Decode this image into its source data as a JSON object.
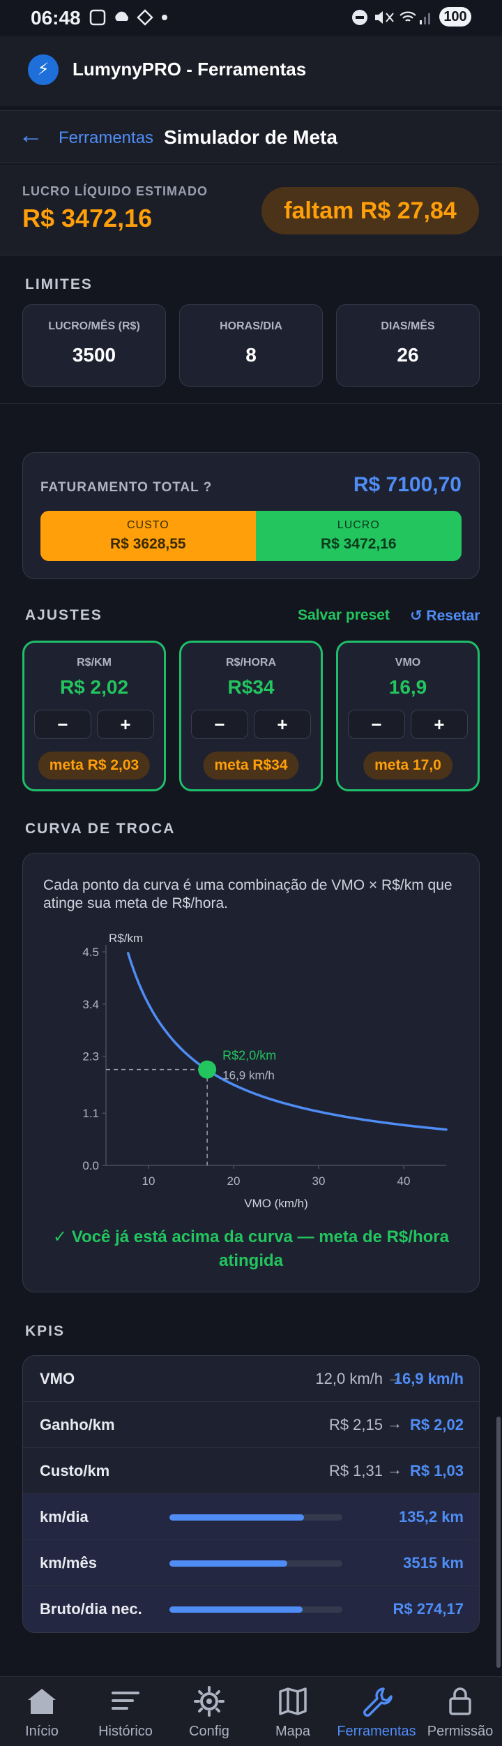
{
  "status_bar": {
    "time": "06:48",
    "battery": "100"
  },
  "app": {
    "title": "LumynyPRO - Ferramentas",
    "logo_icon": "bolt-icon"
  },
  "breadcrumb": {
    "parent": "Ferramentas",
    "title": "Simulador de Meta"
  },
  "summary": {
    "label": "LUCRO LÍQUIDO ESTIMADO",
    "value": "R$ 3472,16",
    "faltam": "faltam R$ 27,84"
  },
  "limites": {
    "title": "LIMITES",
    "items": [
      {
        "label": "LUCRO/MÊS (R$)",
        "value": "3500"
      },
      {
        "label": "HORAS/DIA",
        "value": "8"
      },
      {
        "label": "DIAS/MÊS",
        "value": "26"
      }
    ]
  },
  "faturamento": {
    "label": "FATURAMENTO TOTAL  ?",
    "value": "R$ 7100,70",
    "custo": {
      "label": "CUSTO",
      "value": "R$ 3628,55",
      "share": 0.511
    },
    "lucro": {
      "label": "LUCRO",
      "value": "R$ 3472,16",
      "share": 0.489
    }
  },
  "ajustes": {
    "title": "AJUSTES",
    "save_label": "Salvar preset",
    "reset_label": "↺ Resetar",
    "minus": "−",
    "plus": "+",
    "items": [
      {
        "label": "R$/KM",
        "value": "R$ 2,02",
        "meta": "meta R$ 2,03"
      },
      {
        "label": "R$/HORA",
        "value": "R$34",
        "meta": "meta R$34"
      },
      {
        "label": "VMO",
        "value": "16,9",
        "meta": "meta 17,0"
      }
    ]
  },
  "curva": {
    "title": "CURVA DE TROCA",
    "description": "Cada ponto da curva é uma combinação de VMO × R$/km que atinge sua meta de R$/hora.",
    "success": "✓ Você já está acima da curva — meta de R$/hora atingida"
  },
  "chart_data": {
    "type": "line",
    "ylabel": "R$/km",
    "xlabel": "VMO (km/h)",
    "x_ticks": [
      "10",
      "20",
      "30",
      "40"
    ],
    "y_ticks": [
      "4.5",
      "3.4",
      "2.3",
      "1.1",
      "0.0"
    ],
    "xlim": [
      5,
      45
    ],
    "ylim": [
      0,
      4.5
    ],
    "series": [
      {
        "curve_constant": 34,
        "x_from": 7.6,
        "x_to": 45
      }
    ],
    "point": {
      "x": 16.9,
      "y": 2.02,
      "label_top": "R$2,0/km",
      "label_bottom": "16,9 km/h"
    },
    "colors": {
      "line": "#4f8df5",
      "point": "#22c55e"
    }
  },
  "kpis": {
    "title": "KPIS",
    "rows": [
      {
        "name": "VMO",
        "from": "12,0 km/h",
        "arrow": "→",
        "to": "16,9 km/h"
      },
      {
        "name": "Ganho/km",
        "from": "R$ 2,15",
        "arrow": "→",
        "to": "R$ 2,02"
      },
      {
        "name": "Custo/km",
        "from": "R$ 1,31",
        "arrow": "→",
        "to": "R$ 1,03"
      },
      {
        "name": "km/dia",
        "bar": 0.78,
        "to": "135,2 km"
      },
      {
        "name": "km/mês",
        "bar": 0.68,
        "to": "3515 km"
      },
      {
        "name": "Bruto/dia nec.",
        "bar": 0.77,
        "to": "R$ 274,17"
      }
    ]
  },
  "nav": {
    "items": [
      {
        "label": "Início",
        "icon": "home-icon"
      },
      {
        "label": "Histórico",
        "icon": "history-icon"
      },
      {
        "label": "Config",
        "icon": "gear-icon"
      },
      {
        "label": "Mapa",
        "icon": "map-icon"
      },
      {
        "label": "Ferramentas",
        "icon": "wrench-icon"
      },
      {
        "label": "Permissão",
        "icon": "lock-icon"
      }
    ]
  },
  "colors": {
    "accent": "#4f8df5",
    "warning": "#ff9f0a",
    "success": "#22c55e",
    "background": "#14161f"
  }
}
